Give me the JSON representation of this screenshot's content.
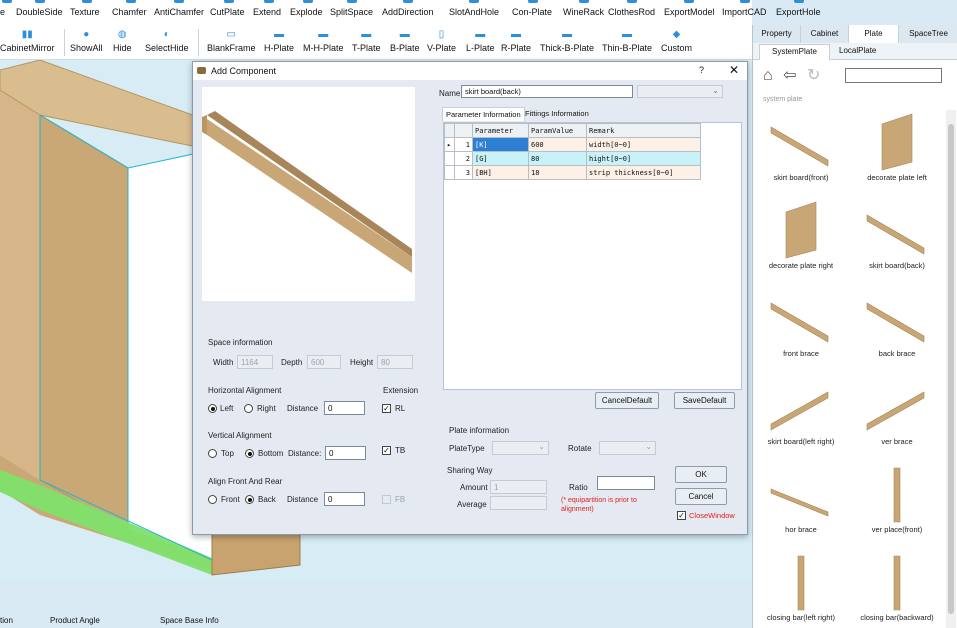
{
  "toolbar1": {
    "items": [
      "e",
      "DoubleSide",
      "Texture",
      "Chamfer",
      "AntiChamfer",
      "CutPlate",
      "Extend",
      "Explode",
      "SplitSpace",
      "AddDirection",
      "SlotAndHole",
      "Con-Plate",
      "WineRack",
      "ClothesRod",
      "ExportModel",
      "ImportCAD",
      "ExportHole"
    ]
  },
  "toolbar2": {
    "items": [
      "CabinetMirror",
      "ShowAll",
      "Hide",
      "SelectHide",
      "BlankFrame",
      "H-Plate",
      "M-H-Plate",
      "T-Plate",
      "B-Plate",
      "V-Plate",
      "L-Plate",
      "R-Plate",
      "Thick-B-Plate",
      "Thin-B-Plate",
      "Custom"
    ]
  },
  "status": {
    "items": [
      "tion",
      "Product Angle",
      "Space Base Info"
    ]
  },
  "right_panel": {
    "tabs": [
      "Property",
      "Cabinet",
      "Plate",
      "SpaceTree"
    ],
    "active_tab": "Plate",
    "subtabs": [
      "SystemPlate",
      "LocalPlate"
    ],
    "path": "system plate",
    "search_value": "",
    "items": [
      "skirt board(front)",
      "decorate plate left",
      "decorate plate right",
      "skirt board(back)",
      "front brace",
      "back brace",
      "skirt board(left right)",
      "ver brace",
      "hor brace",
      "ver place(front)",
      "closing bar(left right)",
      "closing bar(backward)"
    ]
  },
  "dialog": {
    "title": "Add Component",
    "help": "?",
    "close": "✕",
    "name_label": "Name:",
    "name_value": "skirt board(back)",
    "tabs": [
      "Parameter Information",
      "Fittings Information"
    ],
    "table": {
      "headers": [
        "Parameter",
        "ParamValue",
        "Remark"
      ],
      "rows": [
        [
          "1",
          "[K]",
          "600",
          "width[0~0]"
        ],
        [
          "2",
          "[G]",
          "80",
          "hight[0~0]"
        ],
        [
          "3",
          "[BH]",
          "18",
          "strip thickness[0~0]"
        ]
      ]
    },
    "cancel_default": "CancelDefault",
    "save_default": "SaveDefault",
    "space_info_label": "Space information",
    "width_label": "Width",
    "width_value": "1164",
    "depth_label": "Depth",
    "depth_value": "600",
    "height_label": "Height",
    "height_value": "80",
    "h_align_label": "Horizontal Alignment",
    "left_label": "Left",
    "right_label": "Right",
    "distance_label": "Distance",
    "h_distance": "0",
    "extension_label": "Extension",
    "rl_label": "RL",
    "v_align_label": "Vertical Alignment",
    "top_label": "Top",
    "bottom_label": "Bottom",
    "distance_colon_label": "Distance:",
    "v_distance": "0",
    "tb_label": "TB",
    "fb_align_label": "Align Front And Rear",
    "front_label": "Front",
    "back_label": "Back",
    "fb_distance": "0",
    "fb_label": "FB",
    "plate_info_label": "Plate information",
    "plate_type_label": "PlateType",
    "rotate_label": "Rotate",
    "sharing_way_label": "Sharing Way",
    "amount_label": "Amount",
    "amount_value": "1",
    "ratio_label": "Ratio",
    "ratio_value": "",
    "average_label": "Average",
    "note": "(* equipartition is prior to alignment)",
    "ok": "OK",
    "cancel": "Cancel",
    "close_window": "CloseWindow"
  },
  "colors": {
    "accent": "#2e8fd8",
    "wood": "#c9a676",
    "highlight_green": "#7ee06a",
    "warning": "#e02020"
  }
}
